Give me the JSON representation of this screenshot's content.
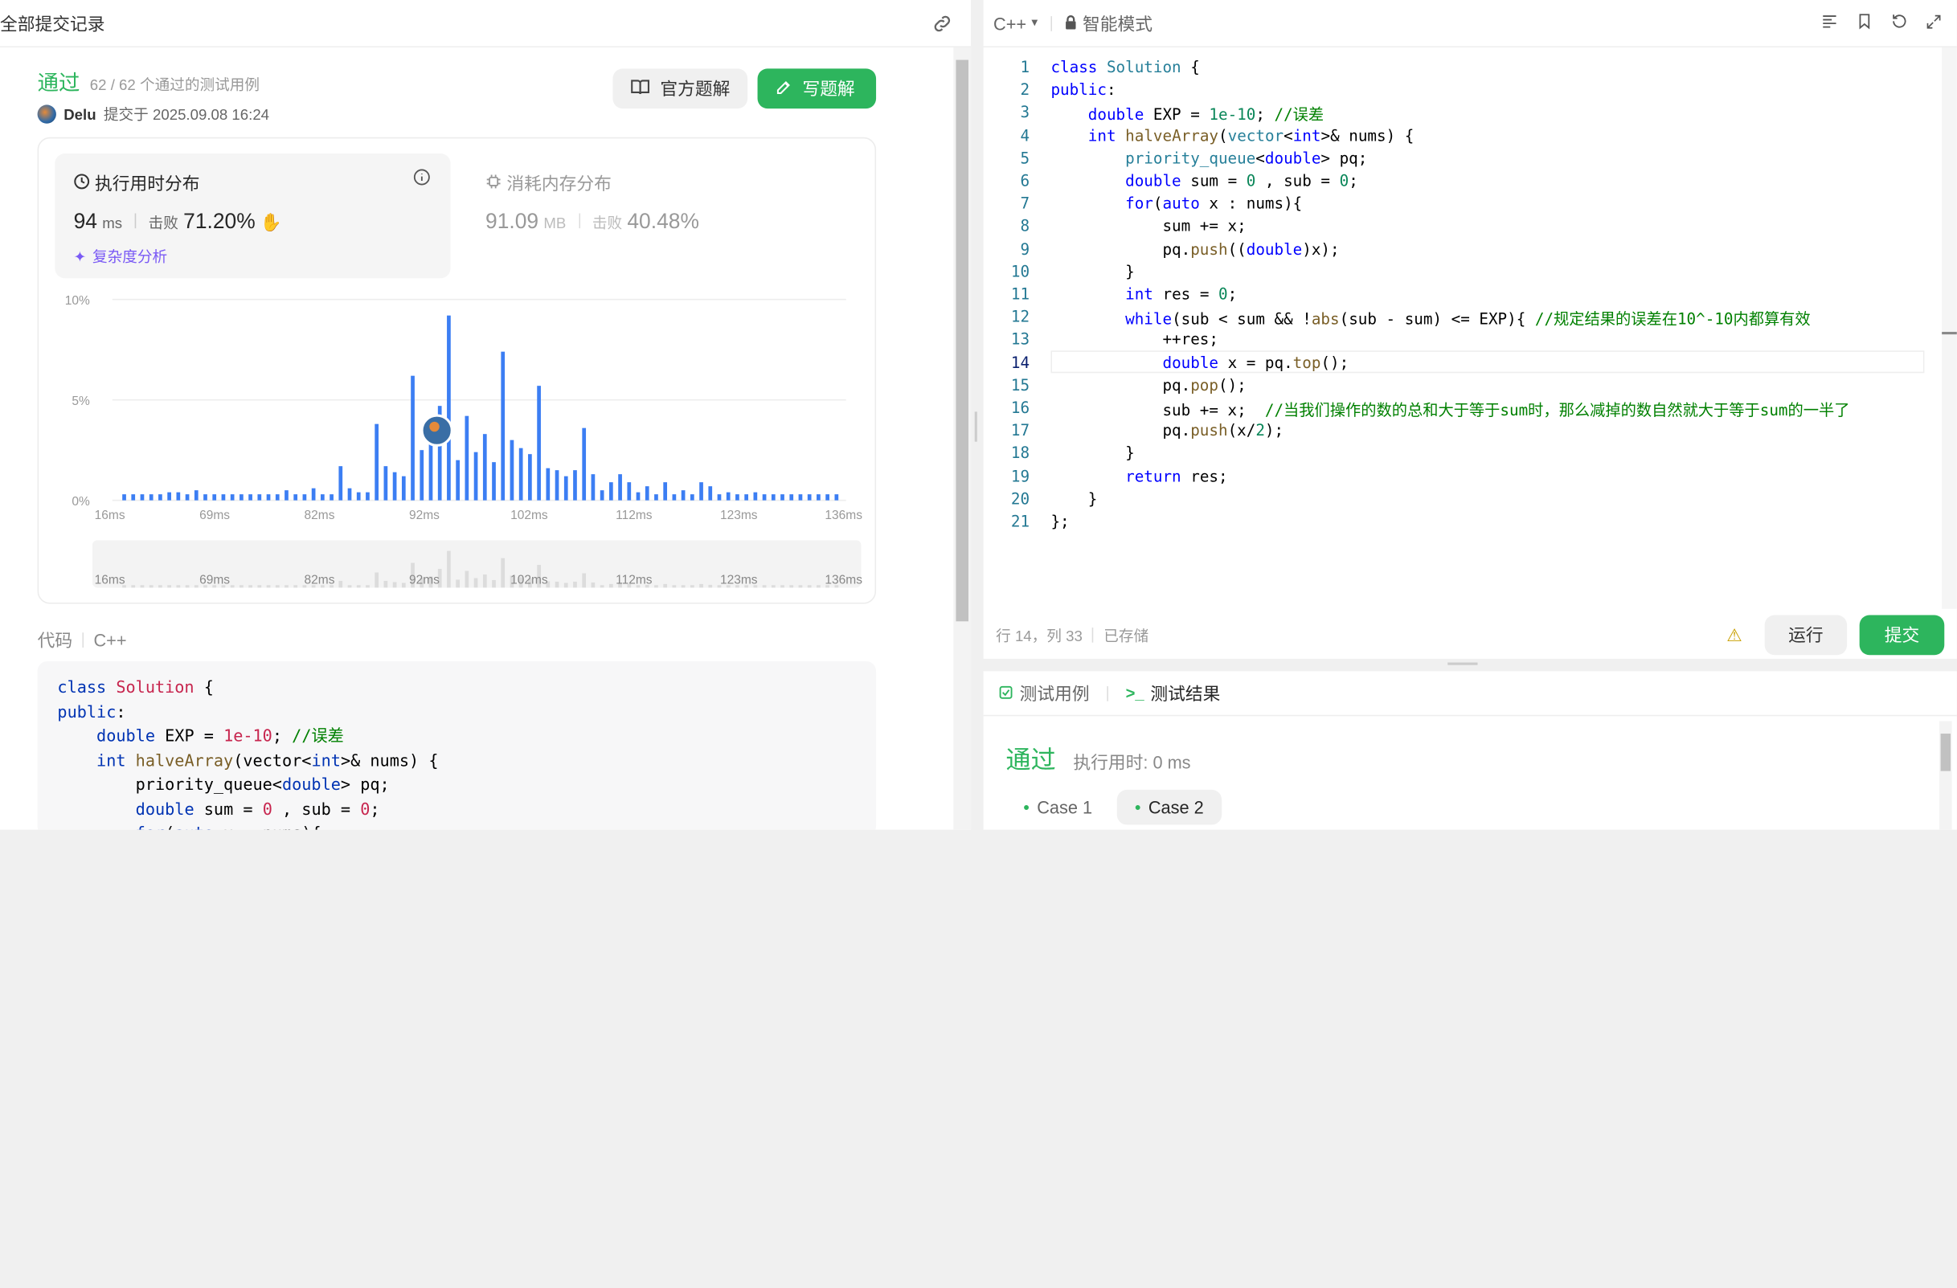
{
  "left": {
    "title": "全部提交记录",
    "status": "通过",
    "tests": "62 / 62 个通过的测试用例",
    "user": "Delu",
    "submitted": "提交于 2025.09.08 16:24",
    "btn_official": "官方题解",
    "btn_write": "写题解",
    "runtime": {
      "label": "执行用时分布",
      "value": "94",
      "unit": "ms",
      "beat_label": "击败",
      "beat": "71.20%",
      "complexity": "复杂度分析"
    },
    "memory": {
      "label": "消耗内存分布",
      "value": "91.09",
      "unit": "MB",
      "beat_label": "击败",
      "beat": "40.48%"
    },
    "code_label": "代码",
    "lang": "C++"
  },
  "chart_data": {
    "type": "bar",
    "ylabel_ticks": [
      "10%",
      "5%",
      "0%"
    ],
    "x_ticks": [
      "16ms",
      "69ms",
      "82ms",
      "92ms",
      "102ms",
      "112ms",
      "123ms",
      "136ms"
    ],
    "ylim": [
      0,
      10
    ],
    "values": [
      0.3,
      0.3,
      0.3,
      0.3,
      0.3,
      0.4,
      0.4,
      0.3,
      0.5,
      0.3,
      0.3,
      0.3,
      0.3,
      0.3,
      0.3,
      0.3,
      0.3,
      0.3,
      0.5,
      0.3,
      0.3,
      0.6,
      0.3,
      0.3,
      1.7,
      0.6,
      0.4,
      0.4,
      3.8,
      1.7,
      1.4,
      1.2,
      6.2,
      2.5,
      2.8,
      4.7,
      9.2,
      2.0,
      4.2,
      2.4,
      3.3,
      1.9,
      7.4,
      3.0,
      2.6,
      2.3,
      5.7,
      1.6,
      1.5,
      1.2,
      1.5,
      3.6,
      1.3,
      0.5,
      0.9,
      1.3,
      0.9,
      0.4,
      0.7,
      0.3,
      0.9,
      0.3,
      0.5,
      0.3,
      0.9,
      0.7,
      0.3,
      0.4,
      0.3,
      0.3,
      0.4,
      0.3,
      0.3,
      0.3,
      0.3,
      0.3,
      0.3,
      0.3,
      0.3,
      0.3
    ],
    "highlight_index": 36,
    "color": "#3c7ef3",
    "grid": true
  },
  "code_lines": [
    [
      [
        "kw",
        "class "
      ],
      [
        "ty",
        "Solution"
      ],
      [
        "pl",
        " {"
      ]
    ],
    [
      [
        "kw",
        "public"
      ],
      [
        "pl",
        ":"
      ]
    ],
    [
      [
        "pl",
        "    "
      ],
      [
        "kw",
        "double"
      ],
      [
        "pl",
        " EXP = "
      ],
      [
        "nm",
        "1e-10"
      ],
      [
        "pl",
        "; "
      ],
      [
        "cm",
        "//误差"
      ]
    ],
    [
      [
        "pl",
        "    "
      ],
      [
        "kw",
        "int"
      ],
      [
        "pl",
        " "
      ],
      [
        "fn",
        "halveArray"
      ],
      [
        "pl",
        "("
      ],
      [
        "ty",
        "vector"
      ],
      [
        "pl",
        "<"
      ],
      [
        "kw",
        "int"
      ],
      [
        "pl",
        ">& nums) {"
      ]
    ],
    [
      [
        "pl",
        "        "
      ],
      [
        "ty",
        "priority_queue"
      ],
      [
        "pl",
        "<"
      ],
      [
        "kw",
        "double"
      ],
      [
        "pl",
        "> pq;"
      ]
    ],
    [
      [
        "pl",
        "        "
      ],
      [
        "kw",
        "double"
      ],
      [
        "pl",
        " sum = "
      ],
      [
        "nm",
        "0"
      ],
      [
        "pl",
        " , sub = "
      ],
      [
        "nm",
        "0"
      ],
      [
        "pl",
        ";"
      ]
    ],
    [
      [
        "pl",
        "        "
      ],
      [
        "kw",
        "for"
      ],
      [
        "pl",
        "("
      ],
      [
        "kw",
        "auto"
      ],
      [
        "pl",
        " x : nums){"
      ]
    ],
    [
      [
        "pl",
        "            sum += x;"
      ]
    ],
    [
      [
        "pl",
        "            pq."
      ],
      [
        "fn",
        "push"
      ],
      [
        "pl",
        "(("
      ],
      [
        "kw",
        "double"
      ],
      [
        "pl",
        ")x);"
      ]
    ],
    [
      [
        "pl",
        "        }"
      ]
    ],
    [
      [
        "pl",
        "        "
      ],
      [
        "kw",
        "int"
      ],
      [
        "pl",
        " res = "
      ],
      [
        "nm",
        "0"
      ],
      [
        "pl",
        ";"
      ]
    ],
    [
      [
        "pl",
        "        "
      ],
      [
        "kw",
        "while"
      ],
      [
        "pl",
        "(sub < sum && !"
      ],
      [
        "fn",
        "abs"
      ],
      [
        "pl",
        "(sub - sum) <= EXP){ "
      ],
      [
        "cm",
        "//规定结果的误差在10^-10内都算有效"
      ]
    ],
    [
      [
        "pl",
        "            ++res;"
      ]
    ],
    [
      [
        "pl",
        "            "
      ],
      [
        "kw",
        "double"
      ],
      [
        "pl",
        " x = pq."
      ],
      [
        "fn",
        "top"
      ],
      [
        "pl",
        "();"
      ]
    ],
    [
      [
        "pl",
        "            pq."
      ],
      [
        "fn",
        "pop"
      ],
      [
        "pl",
        "();"
      ]
    ],
    [
      [
        "pl",
        "            sub += x;  "
      ],
      [
        "cm",
        "//当我们操作的数的总和大于等于sum时，那么减掉的数自然就大于等于sum的一半了"
      ]
    ],
    [
      [
        "pl",
        "            pq."
      ],
      [
        "fn",
        "push"
      ],
      [
        "pl",
        "(x/"
      ],
      [
        "nm",
        "2"
      ],
      [
        "pl",
        ");"
      ]
    ],
    [
      [
        "pl",
        "        }"
      ]
    ],
    [
      [
        "pl",
        "        "
      ],
      [
        "kw",
        "return"
      ],
      [
        "pl",
        " res;"
      ]
    ],
    [
      [
        "pl",
        "    }"
      ]
    ],
    [
      [
        "pl",
        "};"
      ]
    ]
  ],
  "left_code": [
    [
      [
        "kw2",
        "class "
      ],
      [
        "cls",
        "Solution"
      ],
      [
        "pl",
        " {"
      ]
    ],
    [
      [
        "kw2",
        "public"
      ],
      [
        "pl",
        ":"
      ]
    ],
    [
      [
        "pl",
        "    "
      ],
      [
        "kw2",
        "double"
      ],
      [
        "pl",
        " EXP = "
      ],
      [
        "cls",
        "1e-10"
      ],
      [
        "pl",
        "; "
      ],
      [
        "cm",
        "//误差"
      ]
    ],
    [
      [
        "pl",
        "    "
      ],
      [
        "kw2",
        "int"
      ],
      [
        "pl",
        " "
      ],
      [
        "fn",
        "halveArray"
      ],
      [
        "pl",
        "(vector<"
      ],
      [
        "kw2",
        "int"
      ],
      [
        "pl",
        ">& nums) {"
      ]
    ],
    [
      [
        "pl",
        "        priority_queue<"
      ],
      [
        "kw2",
        "double"
      ],
      [
        "pl",
        "> pq;"
      ]
    ],
    [
      [
        "pl",
        "        "
      ],
      [
        "kw2",
        "double"
      ],
      [
        "pl",
        " sum = "
      ],
      [
        "cls",
        "0"
      ],
      [
        "pl",
        " , sub = "
      ],
      [
        "cls",
        "0"
      ],
      [
        "pl",
        ";"
      ]
    ],
    [
      [
        "pl",
        "        "
      ],
      [
        "kw2",
        "for"
      ],
      [
        "pl",
        "("
      ],
      [
        "kw2",
        "auto"
      ],
      [
        "pl",
        " x : nums){"
      ]
    ]
  ],
  "editor": {
    "lang": "C++",
    "mode": "智能模式",
    "cursor": "行 14，列 33",
    "saved": "已存储",
    "run": "运行",
    "submit": "提交"
  },
  "result": {
    "tab_cases": "测试用例",
    "tab_result": "测试结果",
    "status": "通过",
    "time": "执行用时: 0 ms",
    "cases": [
      "Case 1",
      "Case 2"
    ]
  }
}
